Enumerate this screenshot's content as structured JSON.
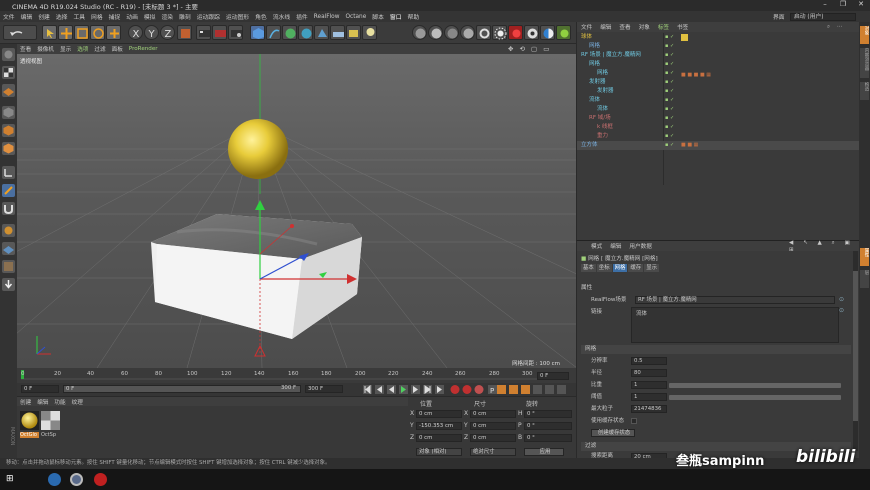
{
  "window": {
    "title": "CINEMA 4D R19.024 Studio (RC - R19) - [未标题 3 *] - 主要",
    "minimize": "–",
    "maximize": "❐",
    "close": "✕"
  },
  "menubar": [
    "文件",
    "编辑",
    "创建",
    "选择",
    "工具",
    "网格",
    "捕捉",
    "动画",
    "模拟",
    "渲染",
    "雕刻",
    "运动跟踪",
    "运动图形",
    "角色",
    "流水线",
    "插件",
    "RealFlow",
    "Octane",
    "脚本",
    "窗口",
    "帮助"
  ],
  "layout": {
    "label": "界面",
    "value": "启动 (用户)"
  },
  "viewport": {
    "menu": [
      "查看",
      "摄像机",
      "显示",
      "选项",
      "过滤",
      "面板",
      "ProRender"
    ],
    "active_menu": "选项",
    "view_name": "透视视图",
    "grid_info": "网格间距 : 100 cm"
  },
  "timeline": {
    "ticks": [
      "0",
      "20",
      "40",
      "60",
      "80",
      "100",
      "120",
      "140",
      "160",
      "180",
      "200",
      "220",
      "240",
      "260",
      "280",
      "300"
    ],
    "end_frame": "0 F"
  },
  "playbar": {
    "start": "0 F",
    "current": "0 F",
    "range_start": "0 F",
    "range_end": "300 F",
    "end": "300 F"
  },
  "materials": {
    "menu": [
      "创建",
      "编辑",
      "功能",
      "纹理"
    ],
    "items": [
      {
        "name": "OctGlo"
      },
      {
        "name": "OctSp"
      }
    ]
  },
  "coords": {
    "headers": {
      "position": "位置",
      "size": "尺寸",
      "rotation": "旋转"
    },
    "rows": [
      {
        "axis": "X",
        "pos": "0 cm",
        "size_axis": "X",
        "size": "0 cm",
        "rot_axis": "H",
        "rot": "0 °"
      },
      {
        "axis": "Y",
        "pos": "-150.353 cm",
        "size_axis": "Y",
        "size": "0 cm",
        "rot_axis": "P",
        "rot": "0 °"
      },
      {
        "axis": "Z",
        "pos": "0 cm",
        "size_axis": "Z",
        "size": "0 cm",
        "rot_axis": "B",
        "rot": "0 °"
      }
    ],
    "mode": "对象 (相对)",
    "size_mode": "绝对尺寸",
    "apply": "应用"
  },
  "object_manager": {
    "menu": [
      "文件",
      "编辑",
      "查看",
      "对象",
      "标签",
      "书签"
    ],
    "objects": [
      {
        "name": "球体",
        "indent": 0,
        "color": "#e0c040"
      },
      {
        "name": "网格",
        "indent": 1,
        "color": "#7ab0e0"
      },
      {
        "name": "RF 场景 | 魔立方.魔精网",
        "indent": 0,
        "color": "#70c8e0"
      },
      {
        "name": "网格",
        "indent": 1,
        "color": "#70c8e0"
      },
      {
        "name": "网格",
        "indent": 2,
        "color": "#70c8e0"
      },
      {
        "name": "发射器",
        "indent": 1,
        "color": "#70c8e0"
      },
      {
        "name": "发射器",
        "indent": 2,
        "color": "#70c8e0"
      },
      {
        "name": "流体",
        "indent": 1,
        "color": "#70c8e0"
      },
      {
        "name": "流体",
        "indent": 2,
        "color": "#70c8e0"
      },
      {
        "name": "RF 域/场",
        "indent": 1,
        "color": "#c87070"
      },
      {
        "name": "k 线框",
        "indent": 2,
        "color": "#c87070"
      },
      {
        "name": "重力",
        "indent": 2,
        "color": "#c87070"
      },
      {
        "name": "立方体",
        "indent": 0,
        "color": "#7ab0e0"
      }
    ]
  },
  "attr_manager": {
    "menu": [
      "模式",
      "编辑",
      "用户数据"
    ],
    "title": "网格 [ 魔立方.魔精网 [网格]",
    "tabs": [
      "基本",
      "坐标",
      "网格",
      "缓存",
      "显示"
    ],
    "active_tab": "网格",
    "section_attr": "属性",
    "realflow_label": "RealFlow场景",
    "realflow_value": "RF 场景 | 魔立方.魔精网",
    "link_label": "链接",
    "link_value": "流体",
    "section_mesh": "网格",
    "params": [
      {
        "label": "分辨率",
        "value": "0.5"
      },
      {
        "label": "半径",
        "value": "80"
      },
      {
        "label": "比重",
        "value": "1"
      },
      {
        "label": "阈值",
        "value": "1"
      },
      {
        "label": "最大粒子",
        "value": "21474836"
      }
    ],
    "use_cache_label": "使用缓存状态",
    "cache_button": "创建缓存状态",
    "section_filter": "过滤",
    "filter_label": "搜索距离",
    "filter_value": "20 cm"
  },
  "status": "移动：点击并拖动鼠标移动元素。按住 SHIFT 键量化移动；节点编辑模式时按住 SHIFT 键增加选择对象；按住 CTRL 键减少选择对象。",
  "watermark": "叁瓶sampinn",
  "bili": "bilibili",
  "right_tabs": [
    "对象",
    "内容浏览器",
    "构造",
    "属性",
    "层"
  ]
}
